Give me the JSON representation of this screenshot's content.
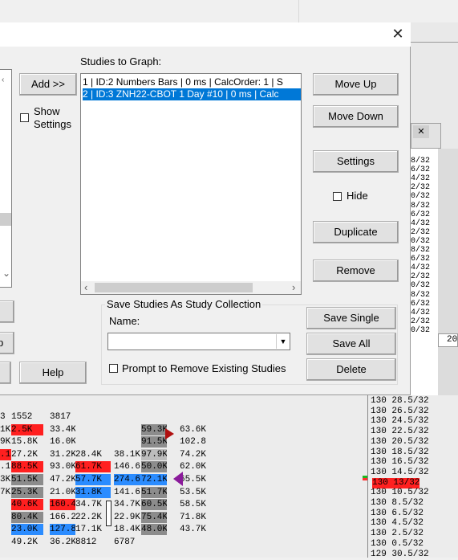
{
  "dialog": {
    "close_label": "✕",
    "studies_to_graph_label": "Studies to Graph:",
    "add_button": "Add >>",
    "show_settings_label": "Show\nSettings",
    "studies": [
      "1 | ID:2  Numbers Bars | 0 ms | CalcOrder: 1 | S",
      "2 | ID:3  ZNH22-CBOT  1 Day   #10 | 0 ms | Calc"
    ],
    "selected_index": 1,
    "buttons": {
      "move_up": "Move Up",
      "move_down": "Move Down",
      "settings": "Settings",
      "hide": "Hide",
      "duplicate": "Duplicate",
      "remove": "Remove",
      "help": "Help",
      "save_single": "Save Single",
      "save_all": "Save All",
      "delete": "Delete",
      "left_partial": "p"
    },
    "collection": {
      "group_label": "Save Studies As Study Collection",
      "name_label": "Name:",
      "name_value": "",
      "prompt_label": "Prompt to Remove Existing Studies"
    }
  },
  "chart": {
    "inner_window_close": "✕",
    "right_top_prices": [
      "8/32",
      "6/32",
      "4/32",
      "2/32",
      "0/32",
      "8/32",
      "6/32",
      "4/32",
      "2/32",
      "0/32",
      "8/32",
      "6/32",
      "4/32",
      "2/32",
      "0/32",
      "8/32",
      "6/32",
      "4/32",
      "2/32",
      "0/32"
    ],
    "axis_label_partial": "20",
    "ladder_prices": [
      "130 28.5/32",
      "130 26.5/32",
      "130 24.5/32",
      "130 22.5/32",
      "130 20.5/32",
      "130 18.5/32",
      "130 16.5/32",
      "130 14.5/32",
      "130 13/32",
      "130 10.5/32",
      "130 8.5/32",
      "130 6.5/32",
      "130 4.5/32",
      "130 2.5/32",
      "130 0.5/32",
      "129 30.5/32"
    ],
    "current_price": "130 13/32",
    "volume_rows": [
      [
        "3",
        "1552",
        "3817",
        "",
        "",
        "",
        "",
        ""
      ],
      [
        "1K",
        "2.5K",
        "33.4K",
        "",
        "",
        "59.3K",
        "",
        "63.6K"
      ],
      [
        "9K",
        "15.8K",
        "16.0K",
        "",
        "",
        "91.5K",
        "",
        "102.8"
      ],
      [
        ".1",
        "27.2K",
        "31.2K",
        "28.4K",
        "38.1K",
        "97.9K",
        "",
        "74.2K"
      ],
      [
        ".1",
        "88.5K",
        "93.0K",
        "61.7K",
        "146.6",
        "50.0K",
        "",
        "62.0K"
      ],
      [
        "3K",
        "51.5K",
        "47.2K",
        "57.7K",
        "274.6",
        "72.1K",
        "",
        "65.5K"
      ],
      [
        "7K",
        "25.3K",
        "21.0K",
        "31.8K",
        "141.6",
        "51.7K",
        "",
        "53.5K"
      ],
      [
        "",
        "40.6K",
        "160.4",
        "34.7K",
        "34.7K",
        "60.5K",
        "",
        "58.5K"
      ],
      [
        "",
        "80.4K",
        "166.2",
        "22.2K",
        "22.9K",
        "75.4K",
        "",
        "71.8K"
      ],
      [
        "",
        "23.0K",
        "127.8",
        "17.1K",
        "18.4K",
        "48.0K",
        "",
        "43.7K"
      ],
      [
        "",
        "49.2K",
        "36.2K",
        "8812",
        "6787",
        "",
        "",
        ""
      ]
    ]
  },
  "colors": {
    "selection": "#0078d7",
    "buy": "#ff1f1f",
    "sell": "#2b8cff",
    "marker_red": "#b01010",
    "marker_purple": "#8a1a9a"
  }
}
